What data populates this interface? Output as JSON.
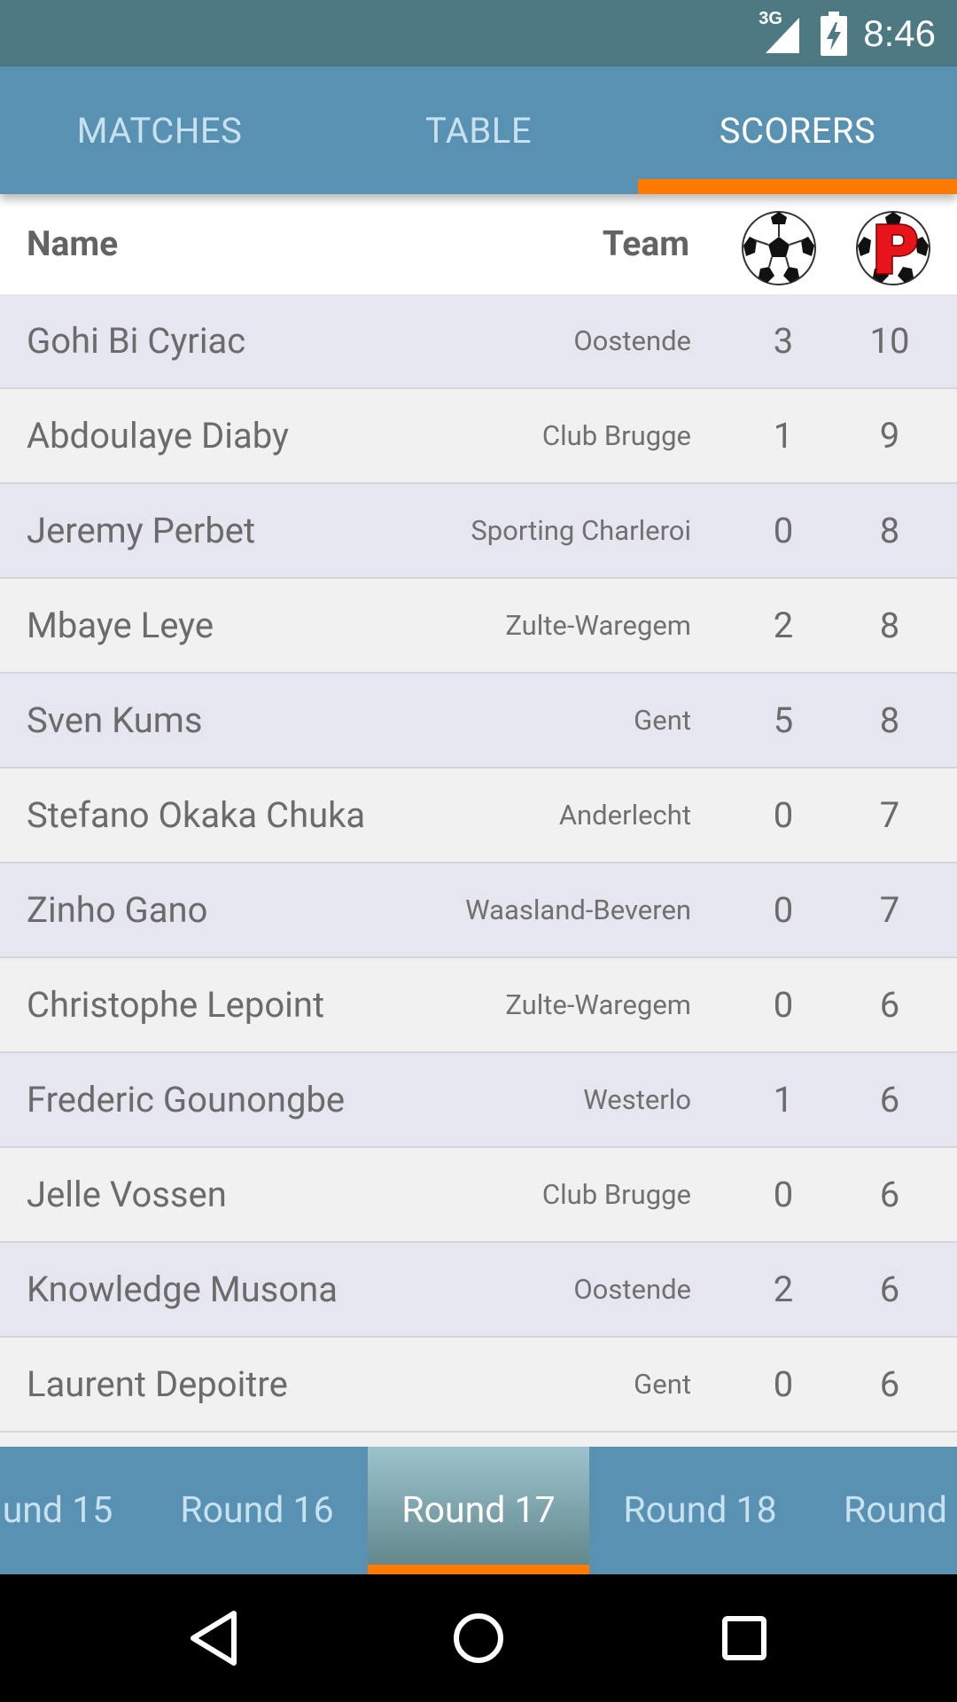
{
  "status": {
    "network": "3G",
    "time": "8:46"
  },
  "tabs": [
    {
      "label": "MATCHES",
      "active": false
    },
    {
      "label": "TABLE",
      "active": false
    },
    {
      "label": "SCORERS",
      "active": true
    }
  ],
  "header": {
    "name": "Name",
    "team": "Team",
    "goals_icon": "soccer-ball-icon",
    "penalty_icon": "penalty-p-icon"
  },
  "scorers": [
    {
      "name": "Gohi Bi Cyriac",
      "team": "Oostende",
      "goals": "3",
      "penalties": "10"
    },
    {
      "name": "Abdoulaye Diaby",
      "team": "Club Brugge",
      "goals": "1",
      "penalties": "9"
    },
    {
      "name": "Jeremy Perbet",
      "team": "Sporting Charleroi",
      "goals": "0",
      "penalties": "8"
    },
    {
      "name": "Mbaye Leye",
      "team": "Zulte-Waregem",
      "goals": "2",
      "penalties": "8"
    },
    {
      "name": "Sven Kums",
      "team": "Gent",
      "goals": "5",
      "penalties": "8"
    },
    {
      "name": "Stefano Okaka Chuka",
      "team": "Anderlecht",
      "goals": "0",
      "penalties": "7"
    },
    {
      "name": "Zinho Gano",
      "team": "Waasland-Beveren",
      "goals": "0",
      "penalties": "7"
    },
    {
      "name": "Christophe Lepoint",
      "team": "Zulte-Waregem",
      "goals": "0",
      "penalties": "6"
    },
    {
      "name": "Frederic Gounongbe",
      "team": "Westerlo",
      "goals": "1",
      "penalties": "6"
    },
    {
      "name": "Jelle Vossen",
      "team": "Club Brugge",
      "goals": "0",
      "penalties": "6"
    },
    {
      "name": "Knowledge Musona",
      "team": "Oostende",
      "goals": "2",
      "penalties": "6"
    },
    {
      "name": "Laurent Depoitre",
      "team": "Gent",
      "goals": "0",
      "penalties": "6"
    }
  ],
  "rounds": [
    {
      "label": "und 15",
      "active": false
    },
    {
      "label": "Round 16",
      "active": false
    },
    {
      "label": "Round 17",
      "active": true
    },
    {
      "label": "Round 18",
      "active": false
    },
    {
      "label": "Round",
      "active": false
    }
  ],
  "colors": {
    "primary": "#5891b1",
    "status_bar": "#4d7983",
    "accent": "#ff7a00",
    "row_odd": "#e6e6f0",
    "row_even": "#f1f1f1"
  }
}
